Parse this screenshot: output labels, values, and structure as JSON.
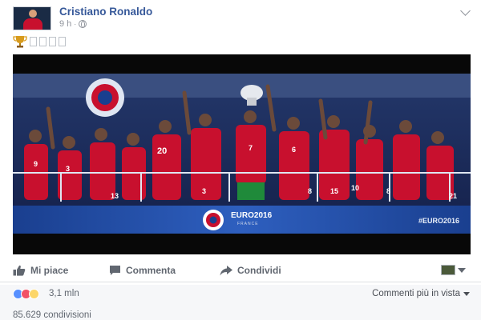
{
  "post": {
    "author": "Cristiano Ronaldo",
    "time": "9 h",
    "separator": "·",
    "visibility_icon": "globe-icon",
    "text_emoji": "trophy-icon"
  },
  "photo": {
    "hashtag": "#EURO2016",
    "logo_title": "EURO2016",
    "logo_subtitle": "FRANCE",
    "jersey_numbers": [
      "9",
      "3",
      "20",
      "3",
      "7",
      "6",
      "8",
      "15",
      "10",
      "8",
      "21",
      "13"
    ]
  },
  "actions": {
    "like_label": "Mi piace",
    "comment_label": "Commenta",
    "share_label": "Condividi"
  },
  "stats": {
    "reactions_count": "3,1 mln",
    "comments_sort_label": "Commenti più in vista",
    "shares_label": "85.629 condivisioni"
  },
  "colors": {
    "link": "#365899",
    "meta": "#90949c",
    "action": "#616770",
    "portugal_red": "#c8102e",
    "stands_blue": "#1a3f8f"
  }
}
